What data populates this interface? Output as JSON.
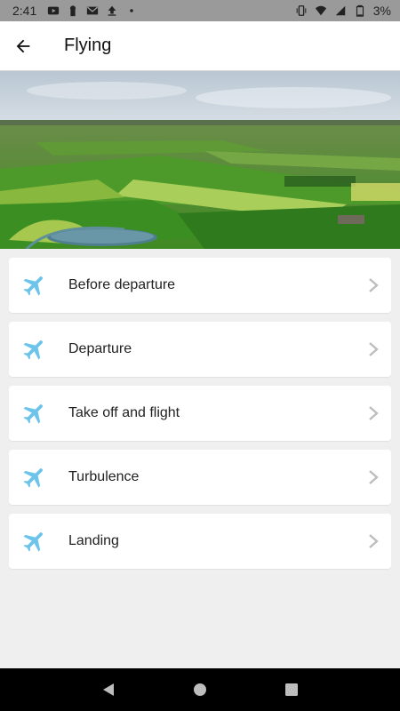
{
  "status_bar": {
    "time": "2:41",
    "battery": "3%",
    "icons_left": [
      "youtube-icon",
      "keyhole-icon",
      "gmail-icon",
      "upload-icon",
      "dot-icon"
    ],
    "icons_right": [
      "vibrate-icon",
      "wifi-icon",
      "signal-icon",
      "battery-icon"
    ]
  },
  "app_bar": {
    "back_icon": "arrow-back-icon",
    "title": "Flying"
  },
  "hero": {
    "image": "aerial-farmland-photo"
  },
  "menu": {
    "items": [
      {
        "label": "Before departure",
        "icon": "airplane-icon"
      },
      {
        "label": "Departure",
        "icon": "airplane-icon"
      },
      {
        "label": "Take off and flight",
        "icon": "airplane-icon"
      },
      {
        "label": "Turbulence",
        "icon": "airplane-icon"
      },
      {
        "label": "Landing",
        "icon": "airplane-icon"
      }
    ]
  },
  "colors": {
    "accent_icon": "#6cc3ec",
    "background": "#efefef",
    "card": "#ffffff",
    "chevron": "#bdbdbd"
  },
  "nav_bar": {
    "buttons": [
      "back-triangle-icon",
      "home-circle-icon",
      "recents-square-icon"
    ]
  }
}
